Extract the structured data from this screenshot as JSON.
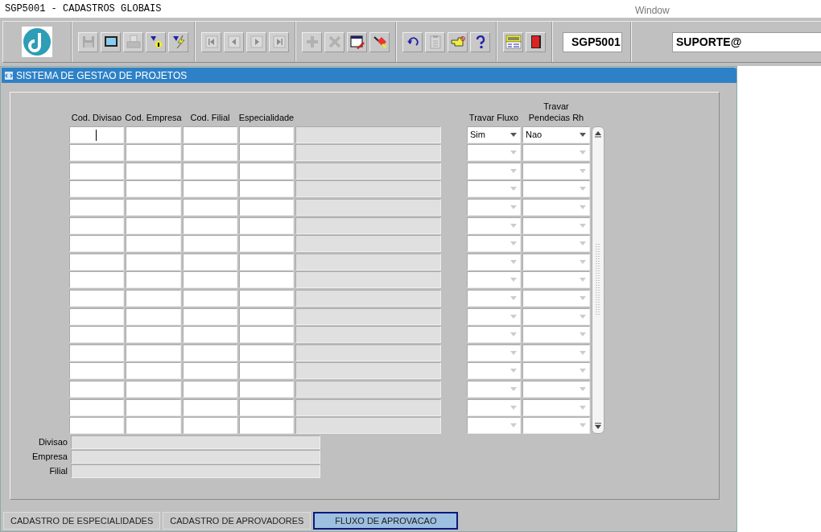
{
  "window": {
    "title": "SGP5001 - CADASTROS GLOBAIS",
    "menu": "Window"
  },
  "toolbar": {
    "groups": [
      [
        {
          "kind": "save",
          "disabled": true
        },
        {
          "kind": "screen",
          "disabled": false
        },
        {
          "kind": "print",
          "disabled": true
        },
        {
          "kind": "query",
          "disabled": false
        },
        {
          "kind": "execute",
          "disabled": false
        }
      ],
      [
        {
          "kind": "first",
          "disabled": true
        },
        {
          "kind": "prev",
          "disabled": true
        },
        {
          "kind": "next",
          "disabled": true
        },
        {
          "kind": "last",
          "disabled": true
        }
      ],
      [
        {
          "kind": "insert",
          "disabled": true
        },
        {
          "kind": "delete",
          "disabled": true
        },
        {
          "kind": "edit",
          "disabled": false
        },
        {
          "kind": "clear",
          "disabled": false
        }
      ],
      [
        {
          "kind": "undo",
          "disabled": false
        },
        {
          "kind": "paste",
          "disabled": true
        },
        {
          "kind": "hand",
          "disabled": false
        },
        {
          "kind": "help",
          "disabled": false
        }
      ],
      [
        {
          "kind": "menu",
          "disabled": false
        },
        {
          "kind": "exit",
          "disabled": false
        }
      ]
    ],
    "form_code": "SGP5001",
    "user": "SUPORTE@"
  },
  "form": {
    "title": "SISTEMA DE GESTAO DE PROJETOS",
    "columns": [
      "Cod. Divisao",
      "Cod. Empresa",
      "Cod. Filial",
      "Especialidade",
      "Travar Fluxo",
      "Travar\nPendecias Rh"
    ],
    "rows": [
      {
        "current": true,
        "travar_fluxo": "Sim",
        "travar_pendencias_rh": "Nao"
      },
      {
        "current": false
      },
      {
        "current": false
      },
      {
        "current": false
      },
      {
        "current": false
      },
      {
        "current": false
      },
      {
        "current": false
      },
      {
        "current": false
      },
      {
        "current": false
      },
      {
        "current": false
      },
      {
        "current": false
      },
      {
        "current": false
      },
      {
        "current": false
      },
      {
        "current": false
      },
      {
        "current": false
      },
      {
        "current": false
      },
      {
        "current": false
      }
    ],
    "details": [
      "Divisao",
      "Empresa",
      "Filial"
    ]
  },
  "tabs": [
    {
      "label": "CADASTRO DE ESPECIALIDADES",
      "selected": false
    },
    {
      "label": "CADASTRO DE APROVADORES",
      "selected": false
    },
    {
      "label": "FLUXO DE APROVACAO",
      "selected": true
    }
  ]
}
